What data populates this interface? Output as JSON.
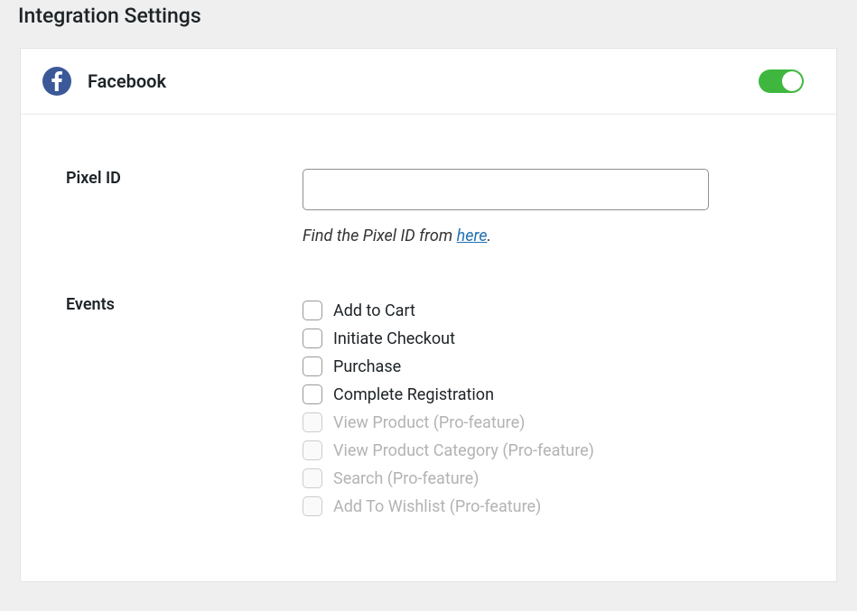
{
  "page": {
    "title": "Integration Settings"
  },
  "accent_color": "#3fb73f",
  "integration": {
    "name": "Facebook",
    "icon": "facebook-icon",
    "enabled": true,
    "fields": {
      "pixel_id": {
        "label": "Pixel ID",
        "value": "",
        "hint_pre": "Find the Pixel ID from ",
        "hint_link": "here",
        "hint_post": "."
      },
      "events": {
        "label": "Events",
        "items": [
          {
            "label": "Add to Cart",
            "checked": false,
            "enabled": true
          },
          {
            "label": "Initiate Checkout",
            "checked": false,
            "enabled": true
          },
          {
            "label": "Purchase",
            "checked": false,
            "enabled": true
          },
          {
            "label": "Complete Registration",
            "checked": false,
            "enabled": true
          },
          {
            "label": "View Product (Pro-feature)",
            "checked": false,
            "enabled": false
          },
          {
            "label": "View Product Category (Pro-feature)",
            "checked": false,
            "enabled": false
          },
          {
            "label": "Search (Pro-feature)",
            "checked": false,
            "enabled": false
          },
          {
            "label": "Add To Wishlist (Pro-feature)",
            "checked": false,
            "enabled": false
          }
        ]
      }
    }
  }
}
